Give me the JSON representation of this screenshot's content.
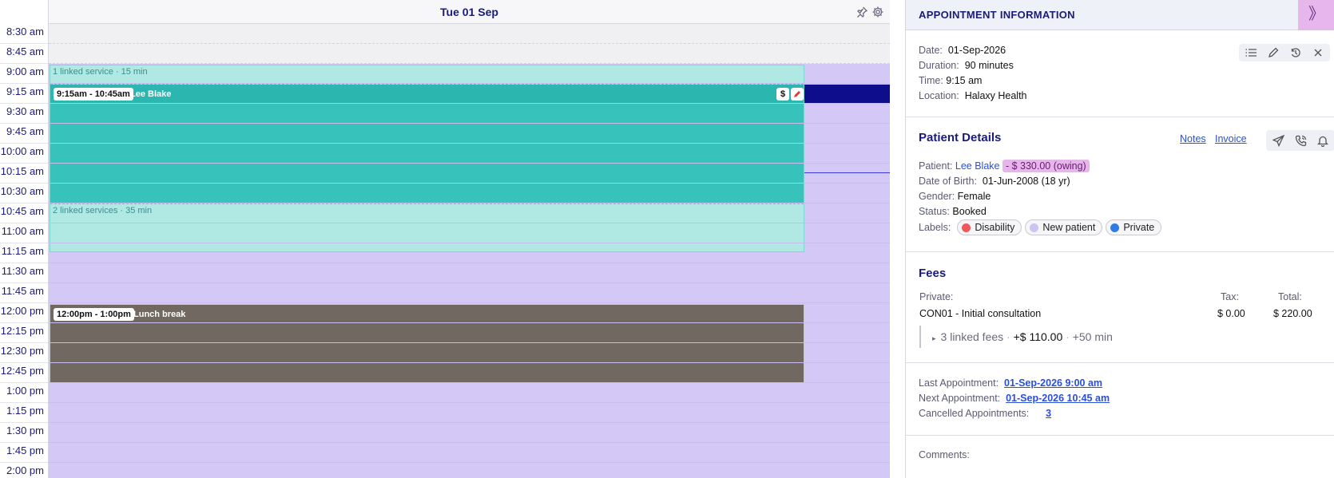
{
  "calendar": {
    "day_title": "Tue 01 Sep",
    "pin_icon": "pin-icon",
    "settings_icon": "gear-icon",
    "times": [
      "8:30 am",
      "8:45 am",
      "9:00 am",
      "9:15 am",
      "9:30 am",
      "9:45 am",
      "10:00 am",
      "10:15 am",
      "10:30 am",
      "10:45 am",
      "11:00 am",
      "11:15 am",
      "11:30 am",
      "11:45 am",
      "12:00 pm",
      "12:15 pm",
      "12:30 pm",
      "12:45 pm",
      "1:00 pm",
      "1:15 pm",
      "1:30 pm",
      "1:45 pm",
      "2:00 pm"
    ],
    "appointment": {
      "linked_before": "1 linked service · 15 min",
      "time": "9:15am - 10:45am",
      "patient": "Lee Blake",
      "fee_btn": "$",
      "linked_after": "2 linked services · 35 min",
      "color_main": "#37c2bc",
      "color_linked": "#b0e8e4"
    },
    "lunch": {
      "time": "12:00pm - 1:00pm",
      "label": "Lunch break",
      "color": "#706861"
    },
    "available_color": "#d4c8f7",
    "now_color": "#0e0e8c"
  },
  "panel": {
    "title": "APPOINTMENT INFORMATION",
    "collapse_icon": "chevron-double-right-icon",
    "info": {
      "date_label": "Date:",
      "date": "01-Sep-2026",
      "duration_label": "Duration:",
      "duration": "90 minutes",
      "time_label": "Time:",
      "time": "9:15 am",
      "location_label": "Location:",
      "location": "Halaxy Health"
    },
    "toolbar_icons": [
      "list-icon",
      "pencil-icon",
      "reschedule-icon",
      "close-icon"
    ],
    "patient": {
      "title": "Patient Details",
      "notes_link": "Notes",
      "invoice_link": "Invoice",
      "action_icons": [
        "send-icon",
        "phone-icon",
        "bell-icon"
      ],
      "patient_label": "Patient:",
      "patient_name": "Lee Blake",
      "owing": "- $ 330.00 (owing)",
      "dob_label": "Date of Birth:",
      "dob": "01-Jun-2008 (18 yr)",
      "gender_label": "Gender:",
      "gender": "Female",
      "status_label": "Status:",
      "status": "Booked",
      "labels_label": "Labels:",
      "labels": [
        {
          "text": "Disability",
          "color": "#f0585a"
        },
        {
          "text": "New patient",
          "color": "#cfc3f4"
        },
        {
          "text": "Private",
          "color": "#2f7be6"
        }
      ]
    },
    "fees": {
      "title": "Fees",
      "type": "Private:",
      "tax_label": "Tax:",
      "total_label": "Total:",
      "item": "CON01 - Initial consultation",
      "tax": "$ 0.00",
      "total": "$ 220.00",
      "linked": "3 linked fees",
      "linked_amount": "+$ 110.00",
      "linked_time": "+50 min"
    },
    "history": {
      "last_label": "Last Appointment:",
      "last": "01-Sep-2026 9:00 am",
      "next_label": "Next Appointment:",
      "next": "01-Sep-2026 10:45 am",
      "cancelled_label": "Cancelled Appointments:",
      "cancelled": "3"
    },
    "comments_label": "Comments:"
  }
}
